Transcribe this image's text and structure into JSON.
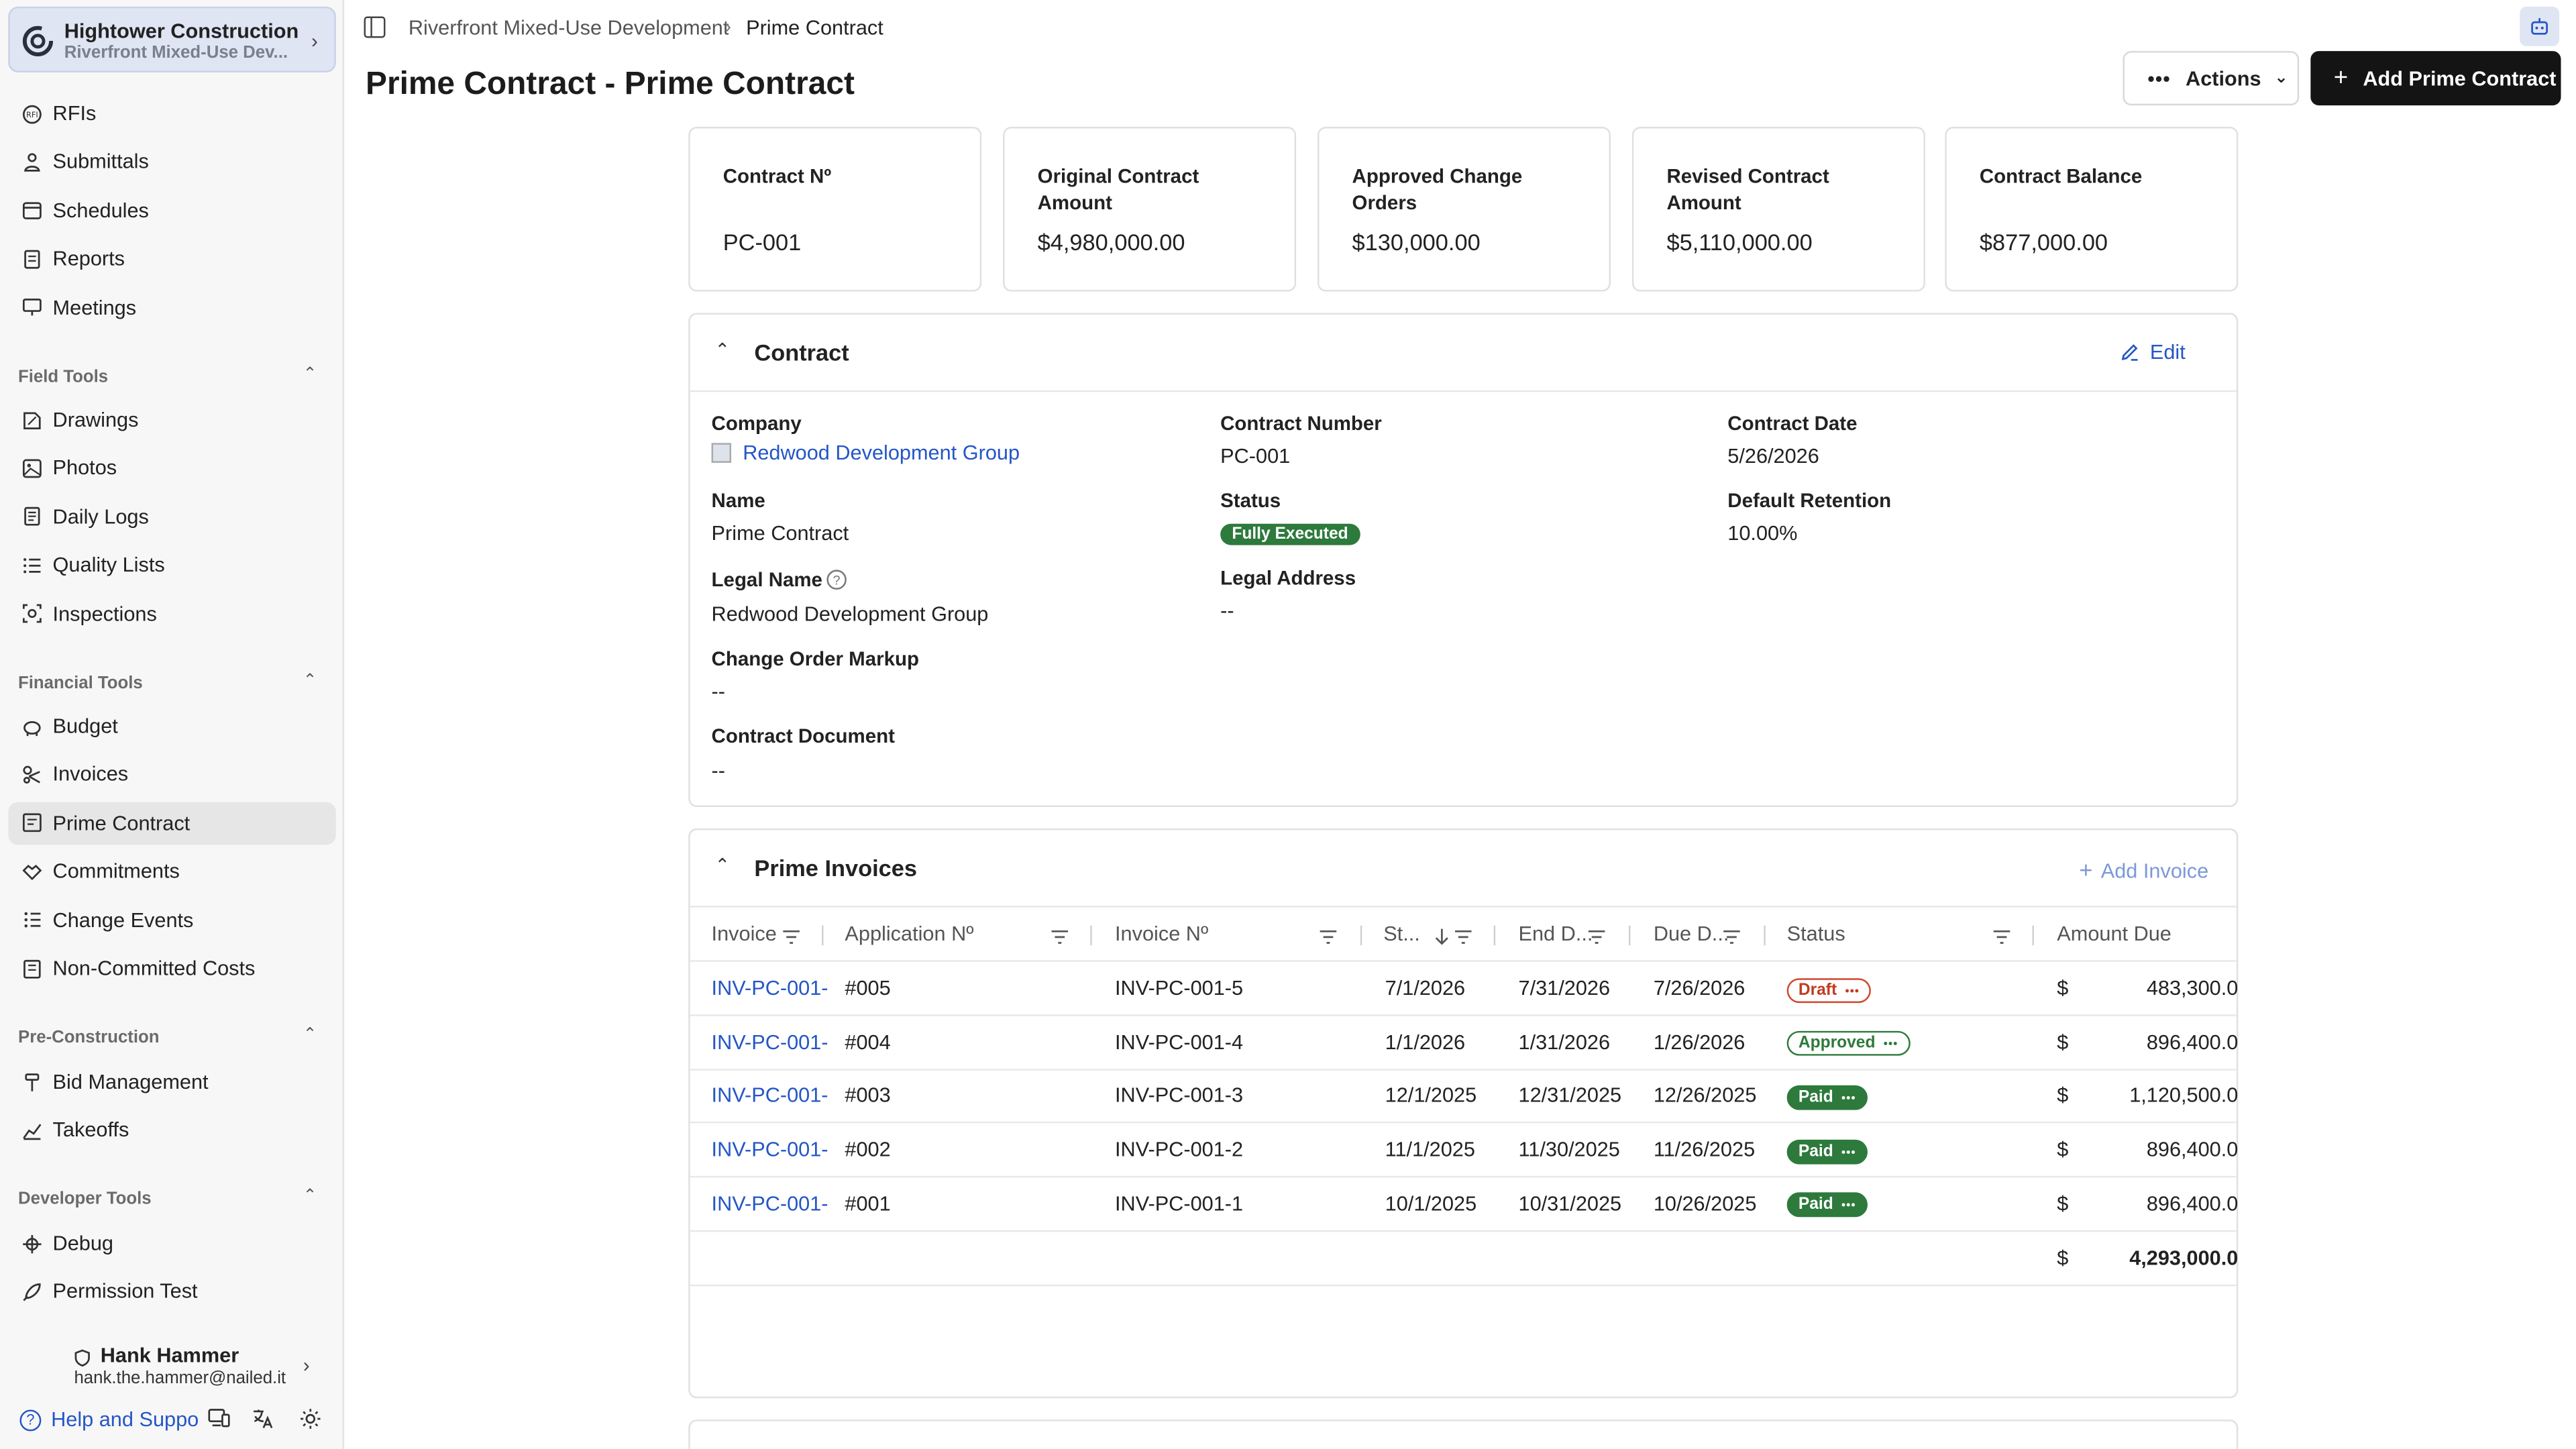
{
  "sidebar": {
    "company": {
      "name": "Hightower Construction",
      "project": "Riverfront Mixed-Use Dev..."
    },
    "top_items": [
      {
        "label": "RFIs",
        "icon": "rfi-icon"
      },
      {
        "label": "Submittals",
        "icon": "submittals-icon"
      },
      {
        "label": "Schedules",
        "icon": "calendar-icon"
      },
      {
        "label": "Reports",
        "icon": "report-icon"
      },
      {
        "label": "Meetings",
        "icon": "meeting-icon"
      }
    ],
    "sections": [
      {
        "label": "Field Tools",
        "items": [
          {
            "label": "Drawings",
            "icon": "drawings-icon"
          },
          {
            "label": "Photos",
            "icon": "photos-icon"
          },
          {
            "label": "Daily Logs",
            "icon": "daily-logs-icon"
          },
          {
            "label": "Quality Lists",
            "icon": "checklist-icon"
          },
          {
            "label": "Inspections",
            "icon": "inspection-icon"
          }
        ]
      },
      {
        "label": "Financial Tools",
        "items": [
          {
            "label": "Budget",
            "icon": "piggy-bank-icon"
          },
          {
            "label": "Invoices",
            "icon": "invoice-icon"
          },
          {
            "label": "Prime Contract",
            "icon": "contract-icon",
            "active": true
          },
          {
            "label": "Commitments",
            "icon": "handshake-icon"
          },
          {
            "label": "Change Events",
            "icon": "change-events-icon"
          },
          {
            "label": "Non-Committed Costs",
            "icon": "costs-icon"
          }
        ]
      },
      {
        "label": "Pre-Construction",
        "items": [
          {
            "label": "Bid Management",
            "icon": "gavel-icon"
          },
          {
            "label": "Takeoffs",
            "icon": "takeoff-icon"
          }
        ]
      },
      {
        "label": "Developer Tools",
        "items": [
          {
            "label": "Debug",
            "icon": "bug-icon"
          },
          {
            "label": "Permission Test",
            "icon": "rocket-icon"
          }
        ]
      }
    ],
    "user": {
      "name": "Hank Hammer",
      "email": "hank.the.hammer@nailed.it"
    },
    "help_label": "Help and Suppo"
  },
  "header": {
    "breadcrumb_project": "Riverfront Mixed-Use Development",
    "breadcrumb_current": "Prime Contract",
    "title": "Prime Contract - Prime Contract",
    "actions_label": "Actions",
    "add_label": "Add Prime Contract"
  },
  "summary": [
    {
      "label": "Contract Nº",
      "value": "PC-001"
    },
    {
      "label": "Original Contract Amount",
      "value": "$4,980,000.00"
    },
    {
      "label": "Approved Change Orders",
      "value": "$130,000.00"
    },
    {
      "label": "Revised Contract Amount",
      "value": "$5,110,000.00"
    },
    {
      "label": "Contract Balance",
      "value": "$877,000.00"
    }
  ],
  "contract": {
    "title": "Contract",
    "edit_label": "Edit",
    "company_label": "Company",
    "company_value": "Redwood Development Group",
    "contract_number_label": "Contract Number",
    "contract_number_value": "PC-001",
    "contract_date_label": "Contract Date",
    "contract_date_value": "5/26/2026",
    "name_label": "Name",
    "name_value": "Prime Contract",
    "status_label": "Status",
    "status_value": "Fully Executed",
    "retention_label": "Default Retention",
    "retention_value": "10.00%",
    "legal_name_label": "Legal Name",
    "legal_name_value": "Redwood Development Group",
    "legal_address_label": "Legal Address",
    "legal_address_value": "--",
    "co_markup_label": "Change Order Markup",
    "co_markup_value": "--",
    "document_label": "Contract Document",
    "document_value": "--"
  },
  "invoices": {
    "title": "Prime Invoices",
    "add_label": "Add Invoice",
    "columns": [
      "Invoice",
      "Application Nº",
      "Invoice Nº",
      "St...",
      "End D...",
      "Due D...",
      "Status",
      "Amount Due"
    ],
    "rows": [
      {
        "invoice": "INV-PC-001-",
        "app": "#005",
        "inv_no": "INV-PC-001-5",
        "start": "7/1/2026",
        "end": "7/31/2026",
        "due": "7/26/2026",
        "status": "Draft",
        "kind": "draft",
        "currency": "$",
        "amount": "483,300.0"
      },
      {
        "invoice": "INV-PC-001-",
        "app": "#004",
        "inv_no": "INV-PC-001-4",
        "start": "1/1/2026",
        "end": "1/31/2026",
        "due": "1/26/2026",
        "status": "Approved",
        "kind": "approved",
        "currency": "$",
        "amount": "896,400.0"
      },
      {
        "invoice": "INV-PC-001-",
        "app": "#003",
        "inv_no": "INV-PC-001-3",
        "start": "12/1/2025",
        "end": "12/31/2025",
        "due": "12/26/2025",
        "status": "Paid",
        "kind": "paid",
        "currency": "$",
        "amount": "1,120,500.0"
      },
      {
        "invoice": "INV-PC-001-",
        "app": "#002",
        "inv_no": "INV-PC-001-2",
        "start": "11/1/2025",
        "end": "11/30/2025",
        "due": "11/26/2025",
        "status": "Paid",
        "kind": "paid",
        "currency": "$",
        "amount": "896,400.0"
      },
      {
        "invoice": "INV-PC-001-",
        "app": "#001",
        "inv_no": "INV-PC-001-1",
        "start": "10/1/2025",
        "end": "10/31/2025",
        "due": "10/26/2025",
        "status": "Paid",
        "kind": "paid",
        "currency": "$",
        "amount": "896,400.0"
      }
    ],
    "total_currency": "$",
    "total_amount": "4,293,000.0"
  },
  "colors": {
    "accent": "#2456c6",
    "paid": "#2d7a3c",
    "draft": "#c23b1f",
    "primary_button": "#141414"
  }
}
